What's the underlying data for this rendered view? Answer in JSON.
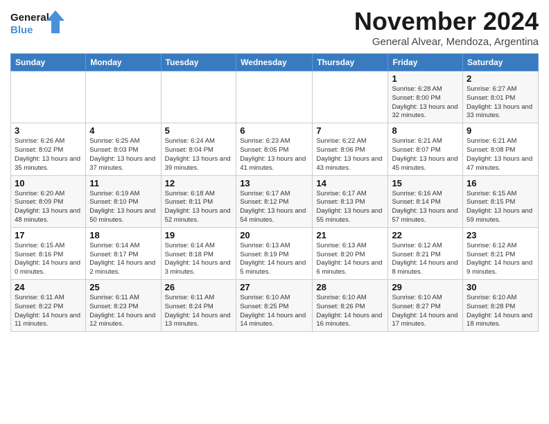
{
  "logo": {
    "line1": "General",
    "line2": "Blue"
  },
  "title": "November 2024",
  "subtitle": "General Alvear, Mendoza, Argentina",
  "days_of_week": [
    "Sunday",
    "Monday",
    "Tuesday",
    "Wednesday",
    "Thursday",
    "Friday",
    "Saturday"
  ],
  "weeks": [
    [
      {
        "day": "",
        "info": ""
      },
      {
        "day": "",
        "info": ""
      },
      {
        "day": "",
        "info": ""
      },
      {
        "day": "",
        "info": ""
      },
      {
        "day": "",
        "info": ""
      },
      {
        "day": "1",
        "info": "Sunrise: 6:28 AM\nSunset: 8:00 PM\nDaylight: 13 hours and 32 minutes."
      },
      {
        "day": "2",
        "info": "Sunrise: 6:27 AM\nSunset: 8:01 PM\nDaylight: 13 hours and 33 minutes."
      }
    ],
    [
      {
        "day": "3",
        "info": "Sunrise: 6:26 AM\nSunset: 8:02 PM\nDaylight: 13 hours and 35 minutes."
      },
      {
        "day": "4",
        "info": "Sunrise: 6:25 AM\nSunset: 8:03 PM\nDaylight: 13 hours and 37 minutes."
      },
      {
        "day": "5",
        "info": "Sunrise: 6:24 AM\nSunset: 8:04 PM\nDaylight: 13 hours and 39 minutes."
      },
      {
        "day": "6",
        "info": "Sunrise: 6:23 AM\nSunset: 8:05 PM\nDaylight: 13 hours and 41 minutes."
      },
      {
        "day": "7",
        "info": "Sunrise: 6:22 AM\nSunset: 8:06 PM\nDaylight: 13 hours and 43 minutes."
      },
      {
        "day": "8",
        "info": "Sunrise: 6:21 AM\nSunset: 8:07 PM\nDaylight: 13 hours and 45 minutes."
      },
      {
        "day": "9",
        "info": "Sunrise: 6:21 AM\nSunset: 8:08 PM\nDaylight: 13 hours and 47 minutes."
      }
    ],
    [
      {
        "day": "10",
        "info": "Sunrise: 6:20 AM\nSunset: 8:09 PM\nDaylight: 13 hours and 48 minutes."
      },
      {
        "day": "11",
        "info": "Sunrise: 6:19 AM\nSunset: 8:10 PM\nDaylight: 13 hours and 50 minutes."
      },
      {
        "day": "12",
        "info": "Sunrise: 6:18 AM\nSunset: 8:11 PM\nDaylight: 13 hours and 52 minutes."
      },
      {
        "day": "13",
        "info": "Sunrise: 6:17 AM\nSunset: 8:12 PM\nDaylight: 13 hours and 54 minutes."
      },
      {
        "day": "14",
        "info": "Sunrise: 6:17 AM\nSunset: 8:13 PM\nDaylight: 13 hours and 55 minutes."
      },
      {
        "day": "15",
        "info": "Sunrise: 6:16 AM\nSunset: 8:14 PM\nDaylight: 13 hours and 57 minutes."
      },
      {
        "day": "16",
        "info": "Sunrise: 6:15 AM\nSunset: 8:15 PM\nDaylight: 13 hours and 59 minutes."
      }
    ],
    [
      {
        "day": "17",
        "info": "Sunrise: 6:15 AM\nSunset: 8:16 PM\nDaylight: 14 hours and 0 minutes."
      },
      {
        "day": "18",
        "info": "Sunrise: 6:14 AM\nSunset: 8:17 PM\nDaylight: 14 hours and 2 minutes."
      },
      {
        "day": "19",
        "info": "Sunrise: 6:14 AM\nSunset: 8:18 PM\nDaylight: 14 hours and 3 minutes."
      },
      {
        "day": "20",
        "info": "Sunrise: 6:13 AM\nSunset: 8:19 PM\nDaylight: 14 hours and 5 minutes."
      },
      {
        "day": "21",
        "info": "Sunrise: 6:13 AM\nSunset: 8:20 PM\nDaylight: 14 hours and 6 minutes."
      },
      {
        "day": "22",
        "info": "Sunrise: 6:12 AM\nSunset: 8:21 PM\nDaylight: 14 hours and 8 minutes."
      },
      {
        "day": "23",
        "info": "Sunrise: 6:12 AM\nSunset: 8:21 PM\nDaylight: 14 hours and 9 minutes."
      }
    ],
    [
      {
        "day": "24",
        "info": "Sunrise: 6:11 AM\nSunset: 8:22 PM\nDaylight: 14 hours and 11 minutes."
      },
      {
        "day": "25",
        "info": "Sunrise: 6:11 AM\nSunset: 8:23 PM\nDaylight: 14 hours and 12 minutes."
      },
      {
        "day": "26",
        "info": "Sunrise: 6:11 AM\nSunset: 8:24 PM\nDaylight: 14 hours and 13 minutes."
      },
      {
        "day": "27",
        "info": "Sunrise: 6:10 AM\nSunset: 8:25 PM\nDaylight: 14 hours and 14 minutes."
      },
      {
        "day": "28",
        "info": "Sunrise: 6:10 AM\nSunset: 8:26 PM\nDaylight: 14 hours and 16 minutes."
      },
      {
        "day": "29",
        "info": "Sunrise: 6:10 AM\nSunset: 8:27 PM\nDaylight: 14 hours and 17 minutes."
      },
      {
        "day": "30",
        "info": "Sunrise: 6:10 AM\nSunset: 8:28 PM\nDaylight: 14 hours and 18 minutes."
      }
    ]
  ]
}
